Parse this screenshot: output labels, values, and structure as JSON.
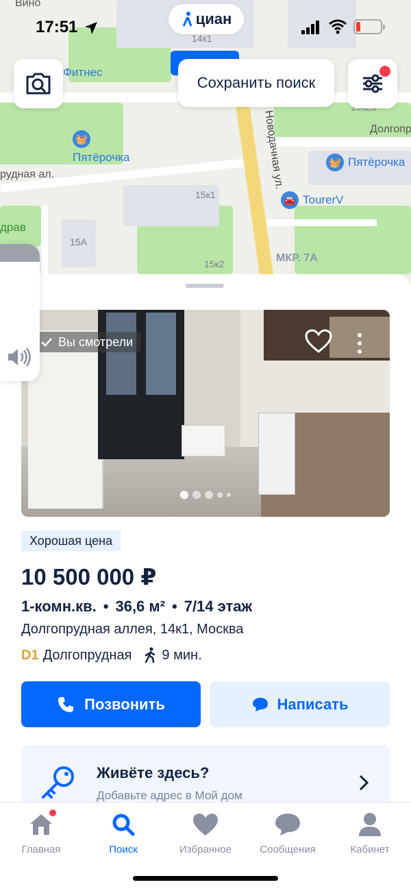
{
  "status_bar": {
    "time": "17:51"
  },
  "brand": {
    "logo_text": "циан"
  },
  "map": {
    "save_search_label": "Сохранить поиск",
    "labels": {
      "fitness": "Фитнес",
      "pyaterochka_1": "Пятёрочка",
      "pyaterochka_2": "Пятёрочка",
      "tourer": "TourerV",
      "novodachnaya": "Новодачная ул.",
      "dolgoprudnaya_top": "Долгопру",
      "prudnaya_al": "рудная ал.",
      "mkr": "МКР. 7А",
      "b14k1": "14к1",
      "b15k1": "15к1",
      "b15k2": "15к2",
      "b15a": "15А",
      "zdrav": "драв",
      "vinog": "Вино",
      "b10k": "10к23"
    }
  },
  "listing": {
    "viewed_badge": "Вы смотрели",
    "tag": "Хорошая цена",
    "price": "10 500 000 ₽",
    "rooms": "1-комн.кв.",
    "area": "36,6 м²",
    "floor": "7/14 этаж",
    "address": "Долгопрудная аллея, 14к1, Москва",
    "metro_line": "D1",
    "metro_station": "Долгопрудная",
    "walk_time": "9 мин.",
    "call_label": "Позвонить",
    "message_label": "Написать",
    "photo_count": 5,
    "photo_current": 1
  },
  "promo": {
    "title": "Живёте здесь?",
    "subtitle": "Добавьте адрес в Мой дом"
  },
  "tabs": [
    {
      "label": "Главная"
    },
    {
      "label": "Поиск"
    },
    {
      "label": "Избранное"
    },
    {
      "label": "Сообщения"
    },
    {
      "label": "Кабинет"
    }
  ],
  "colors": {
    "accent": "#0468ff",
    "text": "#152242",
    "alert": "#ff3b4d"
  }
}
